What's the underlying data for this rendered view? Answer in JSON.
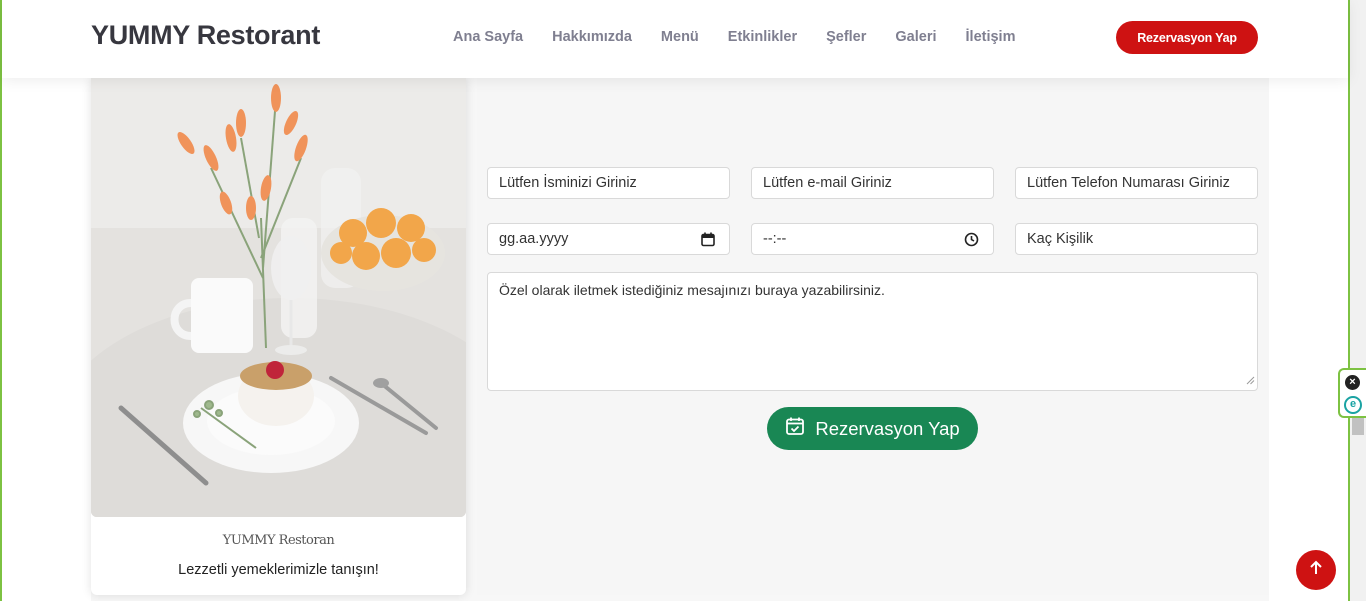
{
  "header": {
    "logo": "YUMMY Restorant",
    "nav": [
      "Ana Sayfa",
      "Hakkımızda",
      "Menü",
      "Etkinlikler",
      "Şefler",
      "Galeri",
      "İletişim"
    ],
    "cta_label": "Rezervasyon Yap"
  },
  "card": {
    "title": "YUMMY Restoran",
    "text": "Lezzetli yemeklerimizle tanışın!"
  },
  "form": {
    "name_placeholder": "Lütfen İsminizi Giriniz",
    "email_placeholder": "Lütfen e-mail Giriniz",
    "phone_placeholder": "Lütfen Telefon Numarası Giriniz",
    "date_value": "gg.aa.yyyy",
    "time_value": "--:--",
    "people_placeholder": "Kaç Kişilik",
    "message_placeholder": "Özel olarak iletmek istediğiniz mesajınızı buraya yazabilirsiniz.",
    "submit_label": "Rezervasyon Yap"
  },
  "colors": {
    "brand_red": "#ce1212",
    "submit_green": "#198754",
    "frame_green": "#7dc242"
  },
  "icons": {
    "calendar": "calendar-icon",
    "clock": "clock-icon",
    "calendar_check": "calendar-check-icon",
    "arrow_up": "arrow-up-icon",
    "close": "close-icon",
    "extension": "extension-e-icon"
  }
}
